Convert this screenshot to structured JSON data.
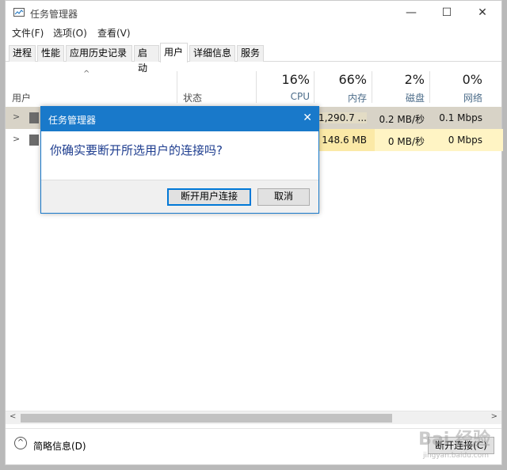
{
  "window": {
    "title": "任务管理器",
    "min": "—",
    "max": "☐",
    "close": "✕"
  },
  "menu": [
    "文件(F)",
    "选项(O)",
    "查看(V)"
  ],
  "tabs": [
    "进程",
    "性能",
    "应用历史记录",
    "启动",
    "用户",
    "详细信息",
    "服务"
  ],
  "active_tab": "用户",
  "columns": {
    "user": "用户",
    "status": "状态",
    "cpu": {
      "pct": "16%",
      "label": "CPU"
    },
    "memory": {
      "pct": "66%",
      "label": "内存"
    },
    "disk": {
      "pct": "2%",
      "label": "磁盘"
    },
    "network": {
      "pct": "0%",
      "label": "网络"
    }
  },
  "rows": [
    {
      "memory": "1,290.7 ...",
      "disk": "0.2 MB/秒",
      "network": "0.1 Mbps"
    },
    {
      "memory": "148.6 MB",
      "disk": "0 MB/秒",
      "network": "0 Mbps"
    }
  ],
  "footer": {
    "fewer_details": "简略信息(D)",
    "disconnect": "断开连接(C)"
  },
  "dialog": {
    "title": "任务管理器",
    "message": "你确实要断开所选用户的连接吗?",
    "confirm": "断开用户连接",
    "cancel": "取消",
    "close": "✕"
  },
  "watermark": {
    "main": "Bai 经验",
    "sub": "jingyan.baidu.com"
  },
  "colors": {
    "accent": "#1979ca",
    "row_selected": "#d8d3c7",
    "heat_light": "#fff4c4",
    "heat_mid": "#fbe9a7"
  }
}
